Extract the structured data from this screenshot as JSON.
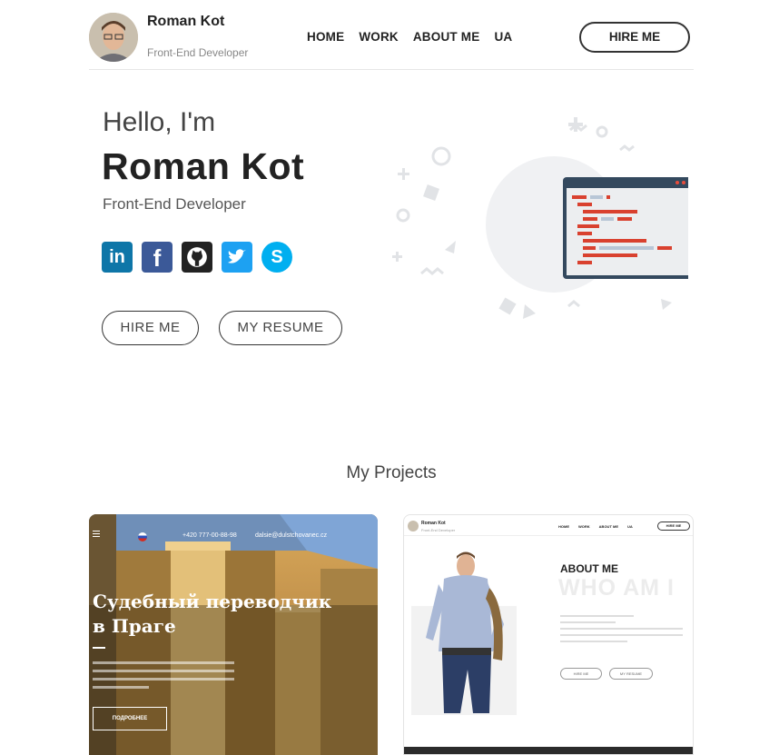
{
  "header": {
    "name": "Roman Kot",
    "role": "Front-End Developer",
    "nav": [
      "HOME",
      "WORK",
      "ABOUT ME",
      "UA"
    ],
    "hire_label": "HIRE ME"
  },
  "hero": {
    "greeting": "Hello, I'm",
    "name": "Roman Kot",
    "role": "Front-End Developer",
    "socials": [
      {
        "name": "linkedin",
        "glyph": "in",
        "color": "#0e76a8"
      },
      {
        "name": "facebook",
        "glyph": "f",
        "color": "#3b5998"
      },
      {
        "name": "github",
        "glyph": "",
        "color": "#222222"
      },
      {
        "name": "twitter",
        "glyph": "",
        "color": "#1da1f2"
      },
      {
        "name": "skype",
        "glyph": "S",
        "color": "#00aff0"
      }
    ],
    "hire_button": "HIRE ME",
    "resume_button": "MY RESUME"
  },
  "projects": {
    "title": "My Projects",
    "card1": {
      "phone": "+420 777-00-88-98",
      "email": "dalsie@dulstchovanec.cz",
      "heading_line1": "Судебный переводчик",
      "heading_line2": "в Праге",
      "button": "ПОДРОБНЕЕ"
    },
    "card2": {
      "brand": "Roman Kot",
      "role": "Front-End Developer",
      "nav": [
        "HOME",
        "WORK",
        "ABOUT ME",
        "UA"
      ],
      "hire": "HIRE ME",
      "about": "ABOUT ME",
      "who": "WHO AM I",
      "btn1": "HIRE ME",
      "btn2": "MY RESUME"
    }
  },
  "colors": {
    "accent": "#222222",
    "code_red": "#d9412f",
    "code_blue": "#34495e"
  }
}
